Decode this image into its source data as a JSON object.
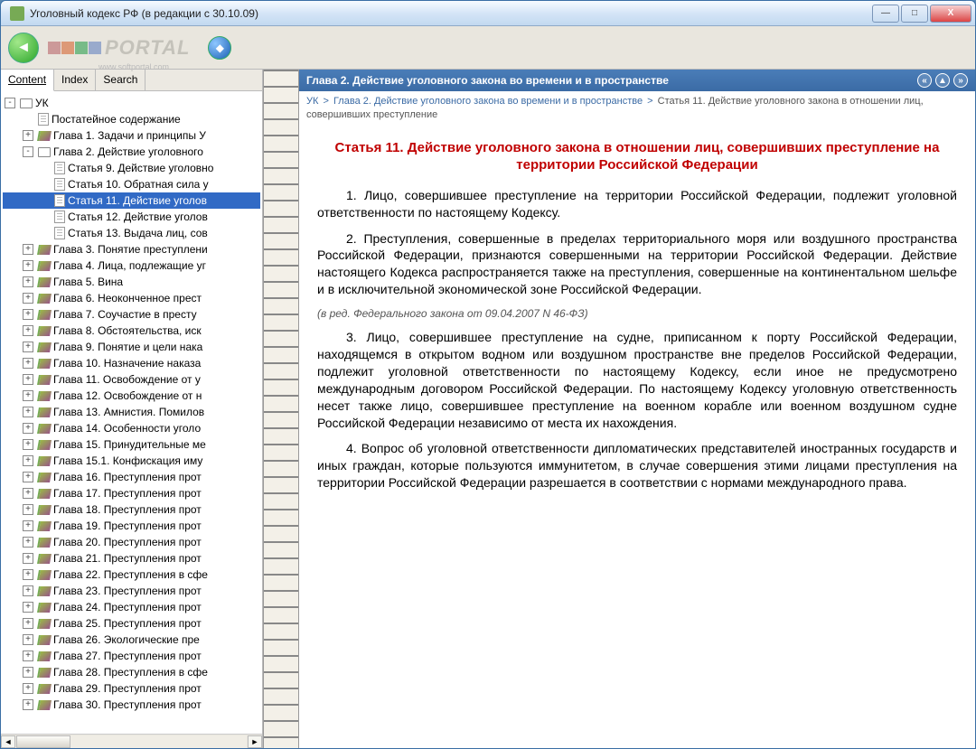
{
  "window": {
    "title": "Уголовный кодекс РФ (в редакции с 30.10.09)"
  },
  "winButtons": {
    "min": "—",
    "max": "□",
    "close": "X"
  },
  "tabs": {
    "content": "Content",
    "index": "Index",
    "search": "Search"
  },
  "logo": {
    "text": "PORTAL",
    "sub": "www.softportal.com"
  },
  "tree": {
    "root": "УК",
    "items": [
      {
        "exp": "",
        "type": "page",
        "label": "Постатейное содержание",
        "indent": 1
      },
      {
        "exp": "+",
        "type": "book",
        "label": "Глава 1. Задачи и принципы У",
        "indent": 1
      },
      {
        "exp": "-",
        "type": "open",
        "label": "Глава 2. Действие уголовного",
        "indent": 1
      },
      {
        "exp": "",
        "type": "page",
        "label": "Статья 9. Действие уголовно",
        "indent": 2
      },
      {
        "exp": "",
        "type": "page",
        "label": "Статья 10. Обратная сила у",
        "indent": 2
      },
      {
        "exp": "",
        "type": "page",
        "label": "Статья 11. Действие уголов",
        "indent": 2,
        "selected": true
      },
      {
        "exp": "",
        "type": "page",
        "label": "Статья 12. Действие уголов",
        "indent": 2
      },
      {
        "exp": "",
        "type": "page",
        "label": "Статья 13. Выдача лиц, сов",
        "indent": 2
      },
      {
        "exp": "+",
        "type": "book",
        "label": "Глава 3. Понятие преступлени",
        "indent": 1
      },
      {
        "exp": "+",
        "type": "book",
        "label": "Глава 4. Лица, подлежащие уг",
        "indent": 1
      },
      {
        "exp": "+",
        "type": "book",
        "label": "Глава 5. Вина",
        "indent": 1
      },
      {
        "exp": "+",
        "type": "book",
        "label": "Глава 6. Неоконченное прест",
        "indent": 1
      },
      {
        "exp": "+",
        "type": "book",
        "label": "Глава 7. Соучастие в престу",
        "indent": 1
      },
      {
        "exp": "+",
        "type": "book",
        "label": "Глава 8. Обстоятельства, иск",
        "indent": 1
      },
      {
        "exp": "+",
        "type": "book",
        "label": "Глава 9. Понятие и цели нака",
        "indent": 1
      },
      {
        "exp": "+",
        "type": "book",
        "label": "Глава 10. Назначение наказа",
        "indent": 1
      },
      {
        "exp": "+",
        "type": "book",
        "label": "Глава 11. Освобождение от у",
        "indent": 1
      },
      {
        "exp": "+",
        "type": "book",
        "label": "Глава 12. Освобождение от н",
        "indent": 1
      },
      {
        "exp": "+",
        "type": "book",
        "label": "Глава 13. Амнистия. Помилов",
        "indent": 1
      },
      {
        "exp": "+",
        "type": "book",
        "label": "Глава 14. Особенности уголо",
        "indent": 1
      },
      {
        "exp": "+",
        "type": "book",
        "label": "Глава 15. Принудительные ме",
        "indent": 1
      },
      {
        "exp": "+",
        "type": "book",
        "label": "Глава 15.1. Конфискация иму",
        "indent": 1
      },
      {
        "exp": "+",
        "type": "book",
        "label": "Глава 16. Преступления прот",
        "indent": 1
      },
      {
        "exp": "+",
        "type": "book",
        "label": "Глава 17. Преступления прот",
        "indent": 1
      },
      {
        "exp": "+",
        "type": "book",
        "label": "Глава 18. Преступления прот",
        "indent": 1
      },
      {
        "exp": "+",
        "type": "book",
        "label": "Глава 19. Преступления прот",
        "indent": 1
      },
      {
        "exp": "+",
        "type": "book",
        "label": "Глава 20. Преступления прот",
        "indent": 1
      },
      {
        "exp": "+",
        "type": "book",
        "label": "Глава 21. Преступления прот",
        "indent": 1
      },
      {
        "exp": "+",
        "type": "book",
        "label": "Глава 22. Преступления в сфе",
        "indent": 1
      },
      {
        "exp": "+",
        "type": "book",
        "label": "Глава 23. Преступления прот",
        "indent": 1
      },
      {
        "exp": "+",
        "type": "book",
        "label": "Глава 24. Преступления прот",
        "indent": 1
      },
      {
        "exp": "+",
        "type": "book",
        "label": "Глава 25. Преступления прот",
        "indent": 1
      },
      {
        "exp": "+",
        "type": "book",
        "label": "Глава 26. Экологические пре",
        "indent": 1
      },
      {
        "exp": "+",
        "type": "book",
        "label": "Глава 27. Преступления прот",
        "indent": 1
      },
      {
        "exp": "+",
        "type": "book",
        "label": "Глава 28. Преступления в сфе",
        "indent": 1
      },
      {
        "exp": "+",
        "type": "book",
        "label": "Глава 29. Преступления прот",
        "indent": 1
      },
      {
        "exp": "+",
        "type": "book",
        "label": "Глава 30. Преступления прот",
        "indent": 1
      }
    ]
  },
  "chapterBar": "Глава 2. Действие уголовного закона во времени и в пространстве",
  "breadcrumb": {
    "p1": "УК",
    "p2": "Глава 2. Действие уголовного закона во времени и в пространстве",
    "p3": "Статья 11. Действие уголовного закона в отношении лиц, совершивших преступление"
  },
  "article": {
    "title": "Статья 11. Действие уголовного закона в отношении лиц, совершивших преступление на территории Российской Федерации",
    "p1": "1. Лицо, совершившее преступление на территории Российской Федерации, подлежит уголовной ответственности по настоящему Кодексу.",
    "p2": "2. Преступления, совершенные в пределах территориального моря или воздушного пространства Российской Федерации, признаются совершенными на территории Российской Федерации. Действие настоящего Кодекса распространяется также на преступления, совершенные на континентальном шельфе и в исключительной экономической зоне Российской Федерации.",
    "note": "(в ред. Федерального закона от 09.04.2007 N 46-ФЗ)",
    "p3": "3. Лицо, совершившее преступление на судне, приписанном к порту Российской Федерации, находящемся в открытом водном или воздушном пространстве вне пределов Российской Федерации, подлежит уголовной ответственности по настоящему Кодексу, если иное не предусмотрено международным договором Российской Федерации. По настоящему Кодексу уголовную ответственность несет также лицо, совершившее преступление на военном корабле или военном воздушном судне Российской Федерации независимо от места их нахождения.",
    "p4": "4. Вопрос об уголовной ответственности дипломатических представителей иностранных государств и иных граждан, которые пользуются иммунитетом, в случае совершения этими лицами преступления на территории Российской Федерации разрешается в соответствии с нормами международного права."
  }
}
